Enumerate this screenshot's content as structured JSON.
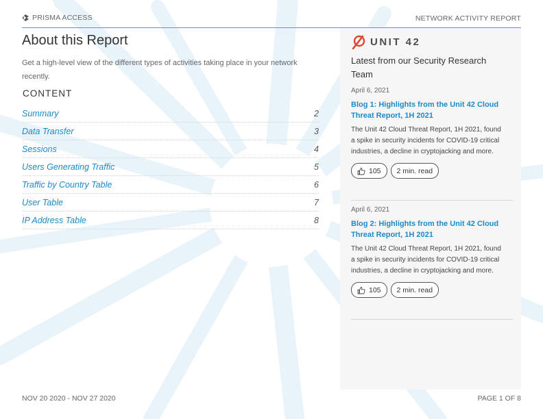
{
  "header": {
    "brand": "PRISMA ACCESS",
    "doc_type": "NETWORK ACTIVITY REPORT"
  },
  "left": {
    "title": "About this Report",
    "description": "Get a high-level view of the different types of activities taking place in your network recently.",
    "content_heading": "CONTENT",
    "toc": [
      {
        "label": "Summary",
        "page": "2"
      },
      {
        "label": "Data Transfer",
        "page": "3"
      },
      {
        "label": "Sessions",
        "page": "4"
      },
      {
        "label": "Users Generating Traffic",
        "page": "5"
      },
      {
        "label": "Traffic by Country Table",
        "page": "6"
      },
      {
        "label": "User Table",
        "page": "7"
      },
      {
        "label": "IP Address Table",
        "page": "8"
      }
    ]
  },
  "panel": {
    "logo_text": "UNIT 42",
    "heading": "Latest from our Security Research Team",
    "posts": [
      {
        "date": "April 6, 2021",
        "title": "Blog 1: Highlights from the Unit 42 Cloud Threat Report, 1H 2021",
        "excerpt": "The Unit 42 Cloud Threat Report, 1H 2021, found a spike in security incidents for COVID-19 critical industries, a decline in cryptojacking and more.",
        "likes": "105",
        "read_time": "2 min. read"
      },
      {
        "date": "April 6, 2021",
        "title": "Blog 2: Highlights from the Unit 42 Cloud Threat Report, 1H 2021",
        "excerpt": "The Unit 42 Cloud Threat Report, 1H 2021, found a spike in security incidents for COVID-19 critical industries, a decline in cryptojacking and more.",
        "likes": "105",
        "read_time": "2 min. read"
      }
    ]
  },
  "footer": {
    "date_range": "NOV 20 2020 - NOV 27 2020",
    "page_indicator": "PAGE 1 OF 8"
  },
  "colors": {
    "accent": "#1a8ac8",
    "rule": "#36a9c9",
    "logo_red": "#e0452f",
    "panel_bg": "#f6f6f6"
  },
  "icons": [
    "prisma-logo-icon",
    "unit42-logo-icon",
    "thumbs-up-icon"
  ]
}
